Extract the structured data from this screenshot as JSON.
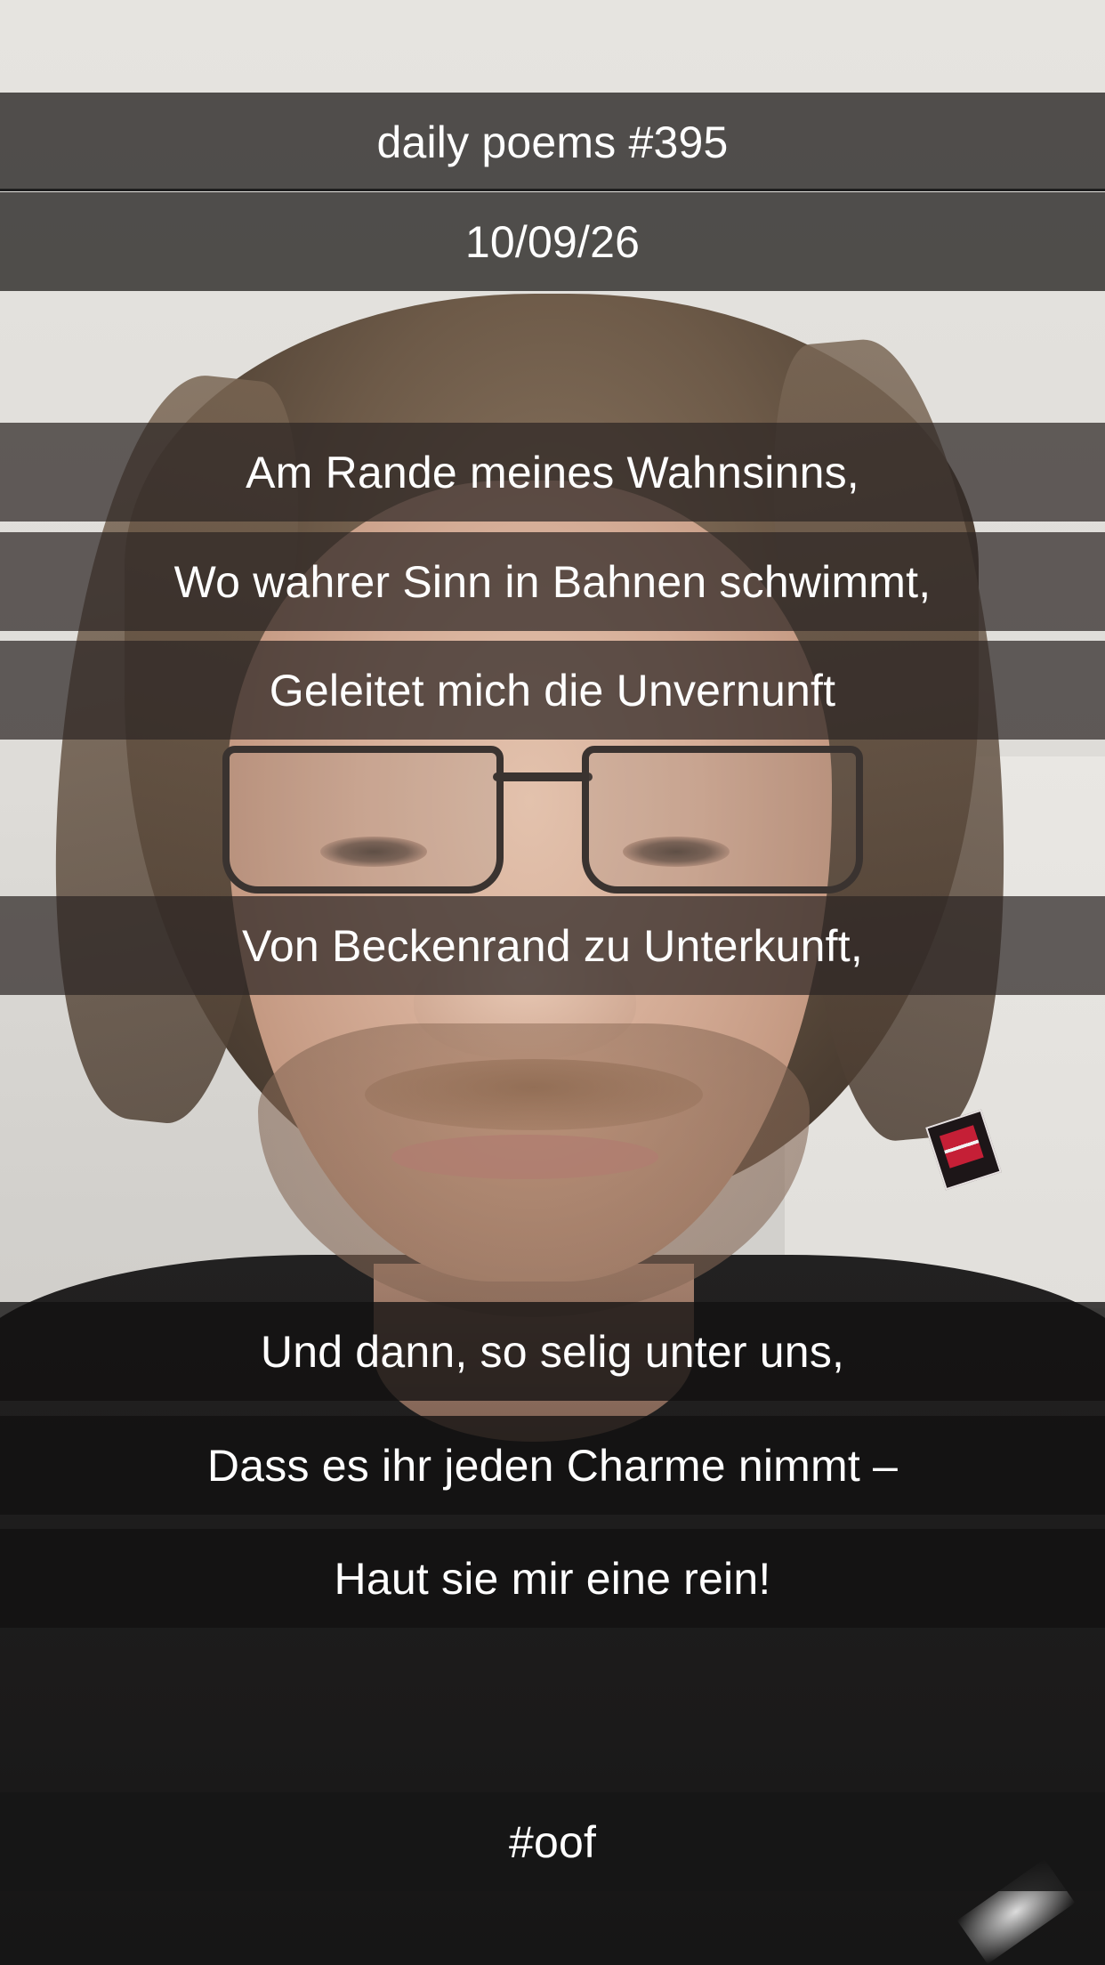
{
  "header": {
    "title": "daily poems #395",
    "date": "10/09/26"
  },
  "poem": {
    "lines": [
      "Am Rande meines Wahnsinns,",
      "Wo wahrer Sinn in Bahnen schwimmt,",
      "Geleitet mich die Unvernunft",
      "Von Beckenrand zu Unterkunft,",
      "Und dann, so selig unter uns,",
      "Dass es ihr jeden Charme nimmt –",
      "Haut sie mir eine rein!"
    ]
  },
  "footer": {
    "hashtag": "#oof"
  }
}
